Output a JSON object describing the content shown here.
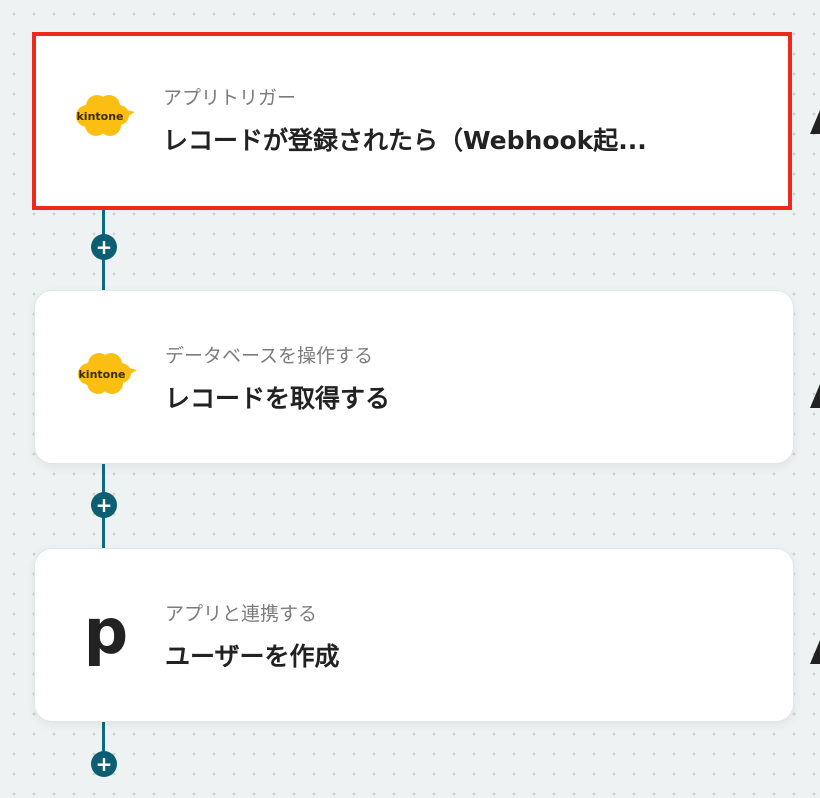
{
  "canvas": {
    "add_step_symbol": "+"
  },
  "steps": [
    {
      "app": "kintone",
      "app_icon": "kintone-logo-icon",
      "logo_text": "kintone",
      "category": "アプリトリガー",
      "title": "レコードが登録されたら（Webhook起...",
      "selected": true
    },
    {
      "app": "kintone",
      "app_icon": "kintone-logo-icon",
      "logo_text": "kintone",
      "category": "データベースを操作する",
      "title": "レコードを取得する",
      "selected": false
    },
    {
      "app": "p",
      "app_icon": "p-logo-icon",
      "logo_text": "p",
      "category": "アプリと連携する",
      "title": "ユーザーを作成",
      "selected": false
    }
  ],
  "colors": {
    "accent": "#0d5e72",
    "selected_border": "#ee2a1a",
    "kintone_yellow": "#fbbf14"
  }
}
